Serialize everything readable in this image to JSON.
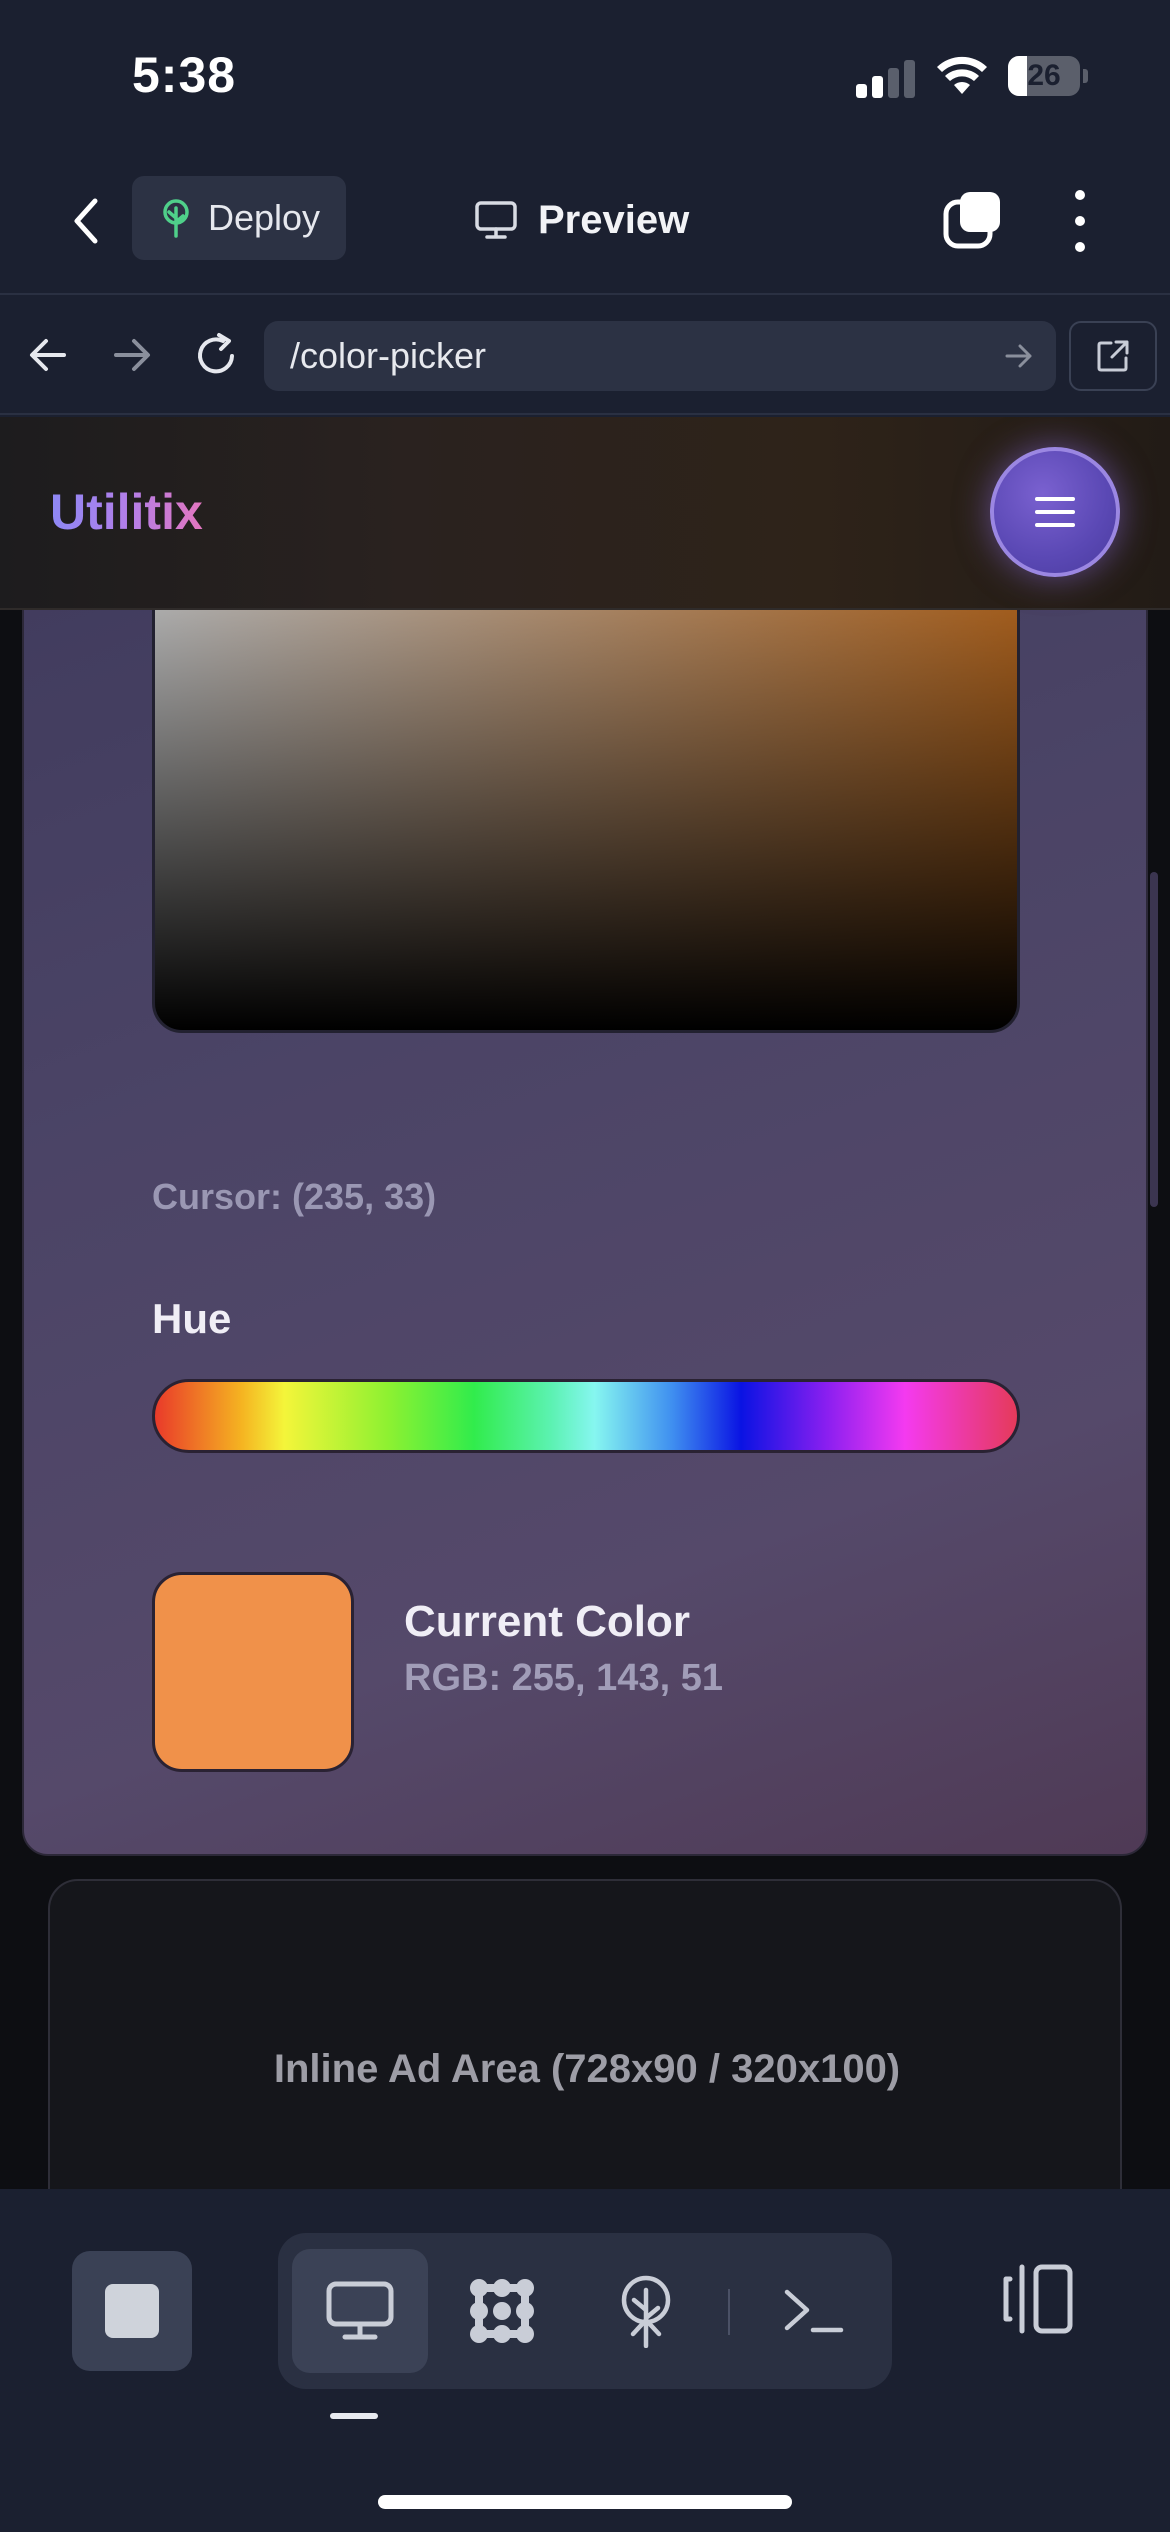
{
  "status_bar": {
    "time": "5:38",
    "battery_level": "26",
    "battery_fraction": 0.26,
    "signal_bars_active": 2,
    "signal_bars_total": 4
  },
  "app_toolbar": {
    "deploy_label": "Deploy",
    "preview_label": "Preview",
    "icons": [
      "chevron-left-icon",
      "tree-icon",
      "monitor-icon",
      "tabs-icon",
      "more-vertical-icon"
    ]
  },
  "browser_bar": {
    "url": "/color-picker",
    "icons": [
      "arrow-left-icon",
      "arrow-right-icon",
      "reload-icon",
      "url-go-arrow-icon",
      "external-link-icon"
    ]
  },
  "site": {
    "brand": "Utilitix",
    "menu_icon": "hamburger-icon"
  },
  "picker": {
    "cursor_readout": "Cursor: (235, 33)",
    "hue_label": "Hue",
    "current_color_title": "Current Color",
    "current_color_rgb": "RGB: 255, 143, 51",
    "swatch_color": "#f0914a",
    "base_hue_color": "#f08a2c"
  },
  "ad": {
    "label": "Inline Ad Area (728x90 / 320x100)"
  },
  "dock": {
    "tools": [
      "monitor-icon",
      "dots-grid-icon",
      "deploy-tree-icon",
      "terminal-icon"
    ],
    "active_tool": "monitor-icon",
    "other_icons": [
      "stop-icon",
      "panel-split-icon"
    ]
  },
  "colors": {
    "background": "#1b2030",
    "toolbar_surface": "#2c3244",
    "card_gradient_start": "#3f3a5c",
    "card_gradient_end": "#4f3a55",
    "brand_gradient_start": "#8d88f5",
    "brand_gradient_end": "#e276bf",
    "menu_button": "#5a48b4"
  }
}
